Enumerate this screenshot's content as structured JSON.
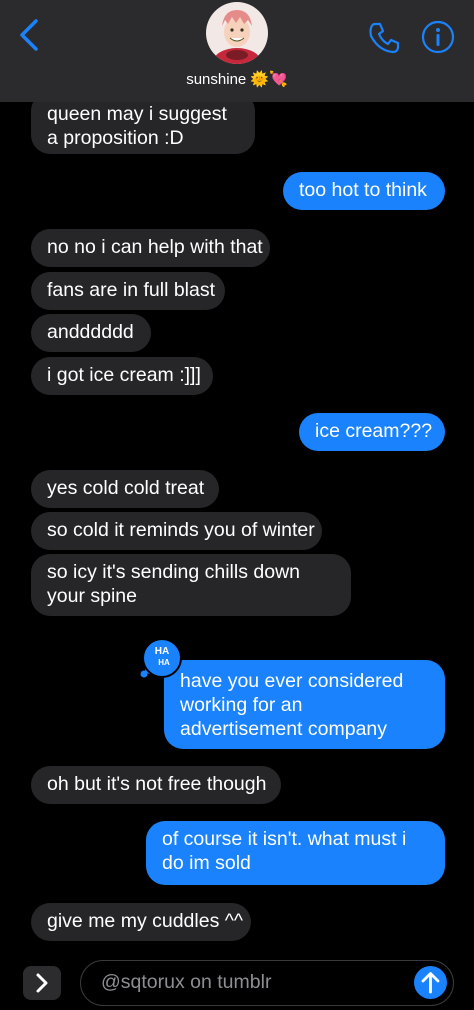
{
  "header": {
    "contact_name": "sunshine 🌞💘",
    "back_icon": "chevron-left-icon",
    "call_icon": "phone-icon",
    "info_icon": "info-icon"
  },
  "messages": [
    {
      "side": "incoming",
      "text": "queen may i suggest a proposition :D"
    },
    {
      "side": "outgoing",
      "text": "too hot to think"
    },
    {
      "side": "incoming",
      "text": "no no i can help with that"
    },
    {
      "side": "incoming",
      "text": "fans are in full blast"
    },
    {
      "side": "incoming",
      "text": "andddddd"
    },
    {
      "side": "incoming",
      "text": "i got ice cream :]]]"
    },
    {
      "side": "outgoing",
      "text": "ice cream???"
    },
    {
      "side": "incoming",
      "text": "yes cold cold treat"
    },
    {
      "side": "incoming",
      "text": "so cold it reminds you of winter"
    },
    {
      "side": "incoming",
      "text": "so icy it's sending chills down your spine"
    },
    {
      "side": "outgoing",
      "text": "have you ever considered working for an advertisement company"
    },
    {
      "side": "incoming",
      "text": "oh but it's not free though"
    },
    {
      "side": "outgoing",
      "text": "of course it isn't. what must i do im sold"
    },
    {
      "side": "incoming",
      "text": "give me my cuddles ^^"
    }
  ],
  "reaction": {
    "label_top": "HA",
    "label_bottom": "HA",
    "icon": "haha-tapback-icon"
  },
  "composer": {
    "input_value": "@sqtorux on tumblr",
    "apps_icon": "chevron-right-icon",
    "send_icon": "arrow-up-icon"
  },
  "colors": {
    "outgoing_bubble": "#1982fc",
    "incoming_bubble": "#262629",
    "header_bg": "#2b2b2e",
    "accent": "#1a82fb"
  }
}
